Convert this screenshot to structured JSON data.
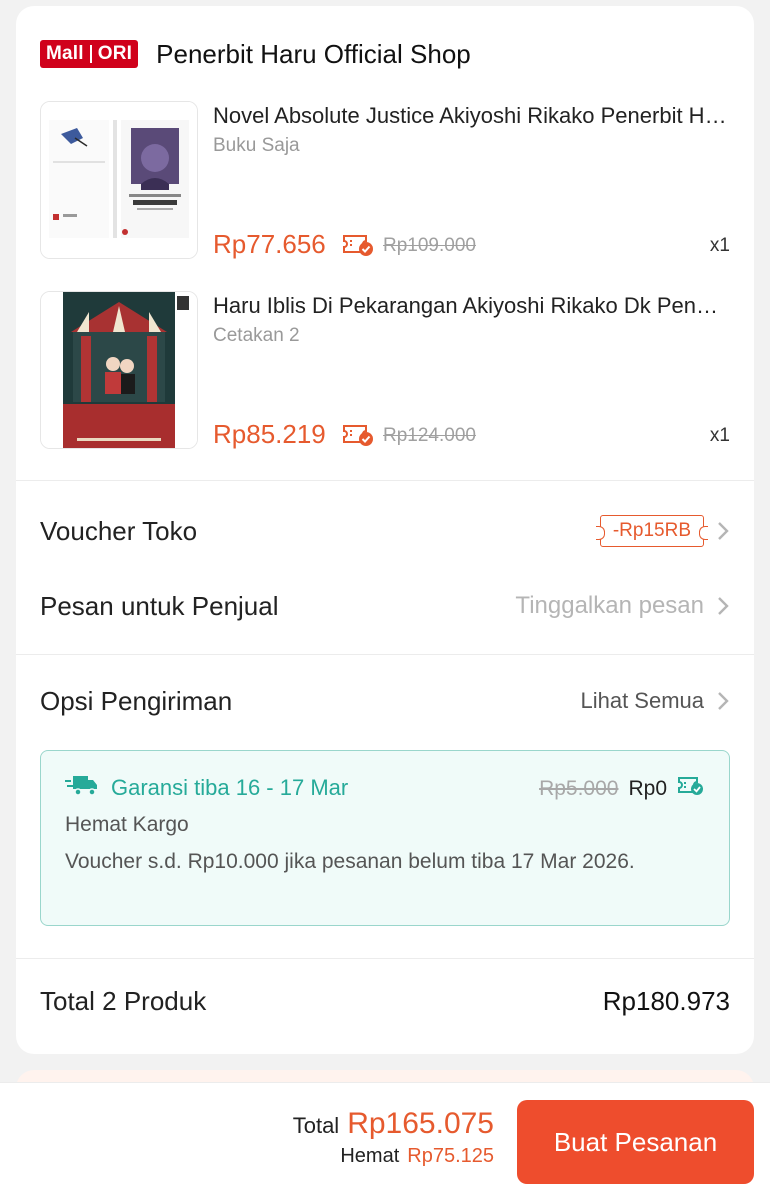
{
  "shop": {
    "badge_left": "Mall",
    "badge_right": "ORI",
    "name": "Penerbit Haru Official Shop"
  },
  "products": [
    {
      "title": "Novel  Absolute Justice Akiyoshi Rikako Penerbit Haru",
      "variant": "Buku Saja",
      "price": "Rp77.656",
      "original_price": "Rp109.000",
      "qty": "x1",
      "cover_title": "Absolute Justice"
    },
    {
      "title": "Haru Iblis Di Pekarangan Akiyoshi Rikako Dk Penerbit Haru",
      "variant": "Cetakan 2",
      "price": "Rp85.219",
      "original_price": "Rp124.000",
      "qty": "x1",
      "cover_title": "IBLIS DI PEKARANGAN"
    }
  ],
  "voucher": {
    "label": "Voucher Toko",
    "value": "-Rp15RB"
  },
  "message": {
    "label": "Pesan untuk Penjual",
    "placeholder": "Tinggalkan pesan"
  },
  "shipping": {
    "label": "Opsi Pengiriman",
    "see_all": "Lihat Semua",
    "guarantee": "Garansi tiba 16 - 17 Mar",
    "original_price": "Rp5.000",
    "price": "Rp0",
    "method": "Hemat Kargo",
    "note": "Voucher s.d.  Rp10.000 jika pesanan belum tiba 17 Mar 2026."
  },
  "subtotal": {
    "label": "Total 2 Produk",
    "value": "Rp180.973"
  },
  "bottom": {
    "total_label": "Total",
    "total_value": "Rp165.075",
    "save_label": "Hemat",
    "save_value": "Rp75.125",
    "order_button": "Buat Pesanan"
  },
  "colors": {
    "accent": "#ee4d2d",
    "price": "#e65a2e",
    "mall_red": "#d0011b",
    "teal": "#26aa99"
  }
}
